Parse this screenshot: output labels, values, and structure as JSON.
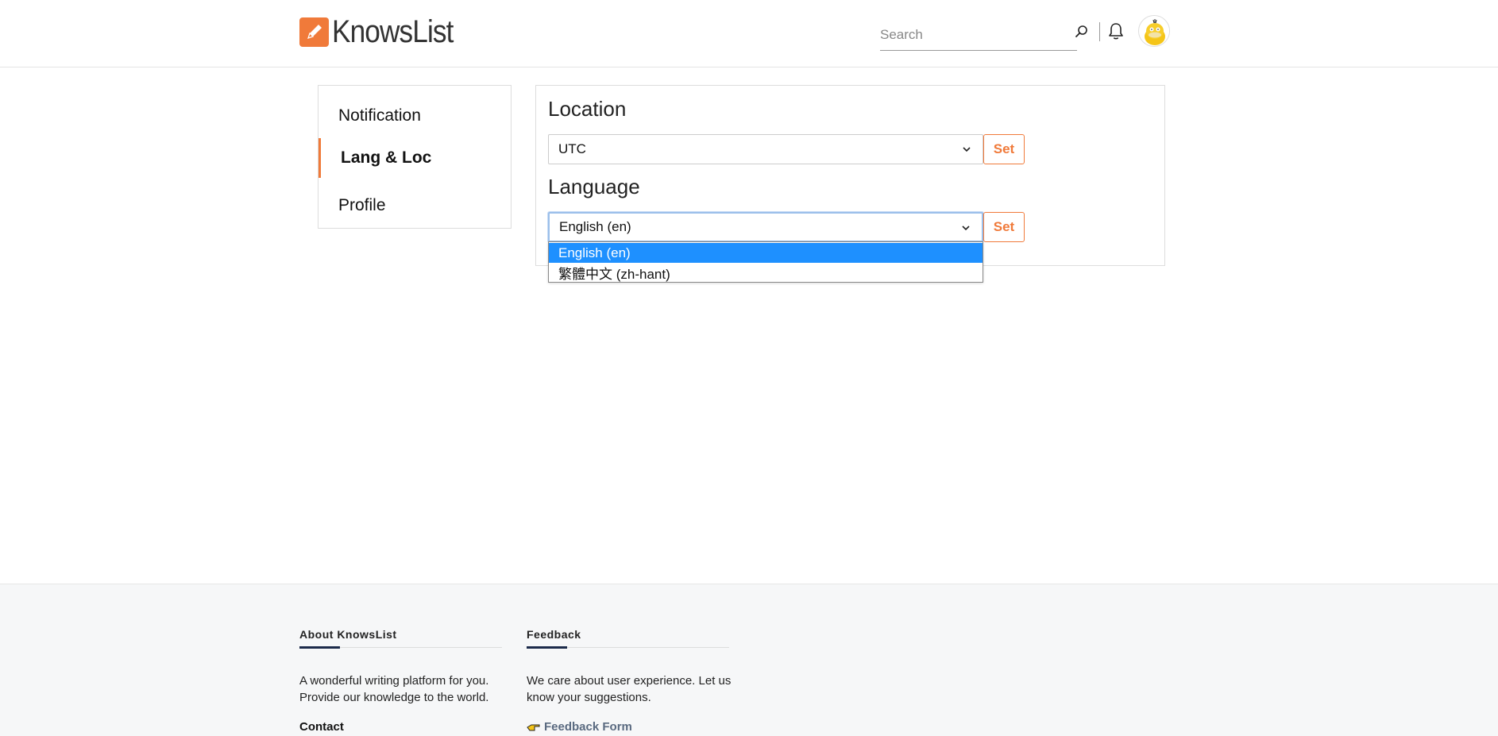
{
  "header": {
    "app_name": "KnowsList",
    "search_placeholder": "Search"
  },
  "sidebar": {
    "items": [
      {
        "label": "Notification"
      },
      {
        "label": "Lang & Loc"
      },
      {
        "label": "Profile"
      }
    ],
    "active_item": "Lang & Loc"
  },
  "main": {
    "location": {
      "title": "Location",
      "selected": "UTC",
      "set_label": "Set"
    },
    "language": {
      "title": "Language",
      "selected": "English (en)",
      "set_label": "Set",
      "options": [
        "English (en)",
        "繁體中文 (zh-hant)"
      ]
    }
  },
  "footer": {
    "about": {
      "heading": "About KnowsList",
      "text": "A wonderful writing platform for you. Provide our knowledge to the world.",
      "contact_label": "Contact"
    },
    "feedback": {
      "heading": "Feedback",
      "text": "We care about user experience. Let us know your suggestions.",
      "link_label": "Feedback Form"
    }
  },
  "colors": {
    "accent": "#f07a3a",
    "selected_option": "#1e90ff",
    "footer_bg": "#f6f7f8"
  }
}
